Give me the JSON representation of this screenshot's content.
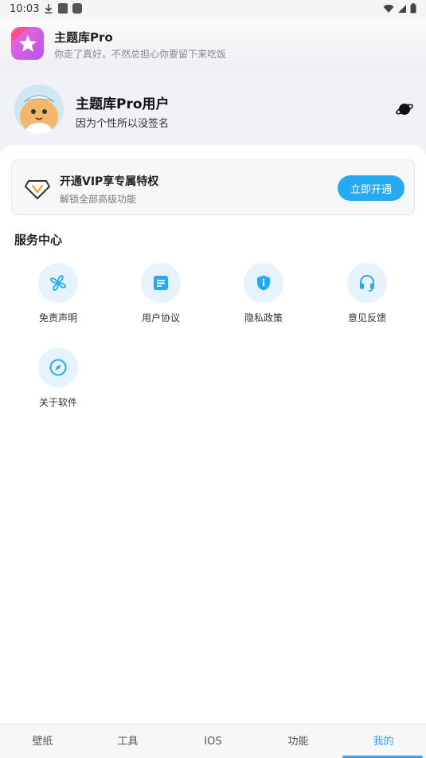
{
  "statusbar": {
    "time": "10:03"
  },
  "app": {
    "title": "主题库Pro",
    "subtitle": "你走了真好。不然总担心你要留下来吃饭"
  },
  "profile": {
    "name": "主题库Pro用户",
    "signature": "因为个性所以没签名"
  },
  "vip": {
    "title": "开通VIP享专属特权",
    "subtitle": "解锁全部高级功能",
    "button": "立即开通"
  },
  "services": {
    "title": "服务中心",
    "items": [
      {
        "label": "免责声明",
        "icon": "pinwheel-icon"
      },
      {
        "label": "用户协议",
        "icon": "document-icon"
      },
      {
        "label": "隐私政策",
        "icon": "shield-icon"
      },
      {
        "label": "意见反馈",
        "icon": "headset-icon"
      },
      {
        "label": "关于软件",
        "icon": "compass-icon"
      }
    ]
  },
  "tabs": [
    {
      "label": "壁纸"
    },
    {
      "label": "工具"
    },
    {
      "label": "IOS"
    },
    {
      "label": "功能"
    },
    {
      "label": "我的"
    }
  ],
  "colors": {
    "accent": "#25a9f0",
    "icon_bg": "#e6f3fc",
    "active_tab": "#3aa0f0"
  }
}
